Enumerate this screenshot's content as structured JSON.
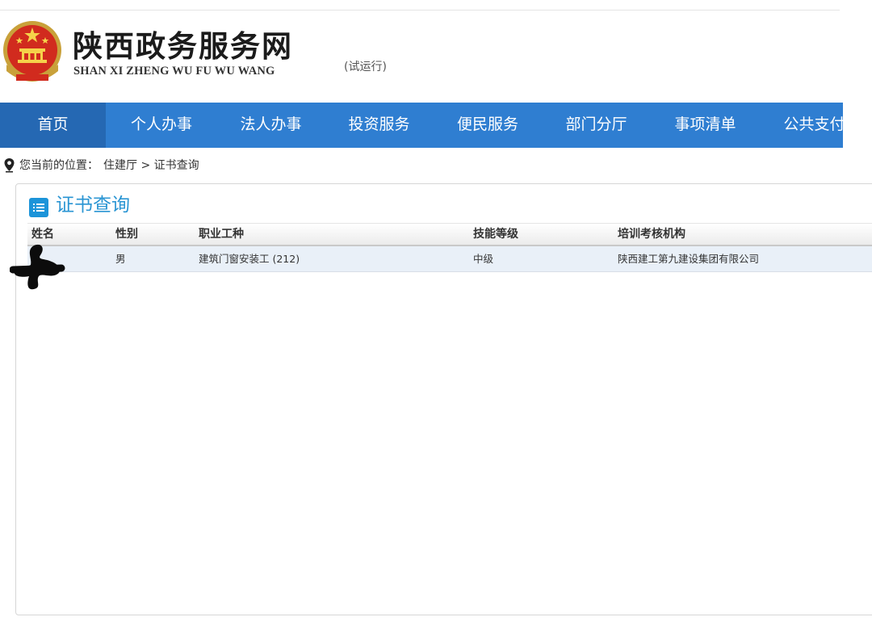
{
  "header": {
    "site_title": "陕西政务服务网",
    "site_subtitle": "SHAN XI ZHENG WU FU WU WANG",
    "trial_tag": "(试运行)"
  },
  "nav": {
    "items": [
      {
        "label": "首页",
        "active": true
      },
      {
        "label": "个人办事",
        "active": false
      },
      {
        "label": "法人办事",
        "active": false
      },
      {
        "label": "投资服务",
        "active": false
      },
      {
        "label": "便民服务",
        "active": false
      },
      {
        "label": "部门分厅",
        "active": false
      },
      {
        "label": "事项清单",
        "active": false
      },
      {
        "label": "公共支付",
        "active": false
      }
    ]
  },
  "breadcrumb": {
    "prefix": "您当前的位置：",
    "path": "住建厅 > 证书查询"
  },
  "panel": {
    "title": "证书查询",
    "columns": [
      "姓名",
      "性别",
      "职业工种",
      "技能等级",
      "培训考核机构"
    ],
    "rows": [
      {
        "name": "",
        "gender": "男",
        "occupation": "建筑门窗安装工 (212)",
        "skill_level": "中级",
        "institution": "陕西建工第九建设集团有限公司"
      }
    ]
  },
  "colors": {
    "nav_bg": "#2f7ed1",
    "nav_active_bg": "#2568b3",
    "title_blue": "#2a95d3",
    "row_highlight": "#e9f0f8"
  }
}
